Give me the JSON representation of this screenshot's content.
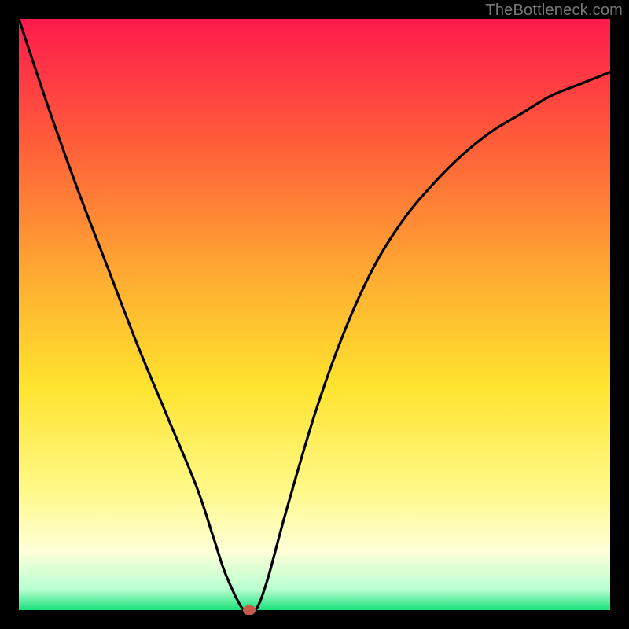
{
  "watermark": "TheBottleneck.com",
  "chart_data": {
    "type": "line",
    "title": "",
    "xlabel": "",
    "ylabel": "",
    "xlim": [
      0,
      100
    ],
    "ylim": [
      0,
      100
    ],
    "grid": false,
    "legend": false,
    "background_gradient_stops": [
      {
        "offset": 0.0,
        "color": "#ff1a4d"
      },
      {
        "offset": 0.2,
        "color": "#ff5a3a"
      },
      {
        "offset": 0.45,
        "color": "#ffb031"
      },
      {
        "offset": 0.62,
        "color": "#ffe32e"
      },
      {
        "offset": 0.8,
        "color": "#fff98a"
      },
      {
        "offset": 0.9,
        "color": "#ffffd8"
      },
      {
        "offset": 0.965,
        "color": "#b8ffcf"
      },
      {
        "offset": 1.0,
        "color": "#18e07a"
      }
    ],
    "x": [
      0,
      5,
      10,
      15,
      20,
      25,
      30,
      33,
      35,
      38,
      40,
      42,
      45,
      50,
      55,
      60,
      65,
      70,
      75,
      80,
      85,
      90,
      95,
      100
    ],
    "y": [
      100,
      85,
      71,
      58,
      45,
      33,
      21,
      12,
      6,
      0,
      0,
      5,
      16,
      33,
      47,
      58,
      66,
      72,
      77,
      81,
      84,
      87,
      89,
      91
    ],
    "marker": {
      "x": 39,
      "y": 0,
      "color": "#c75b4b"
    }
  }
}
